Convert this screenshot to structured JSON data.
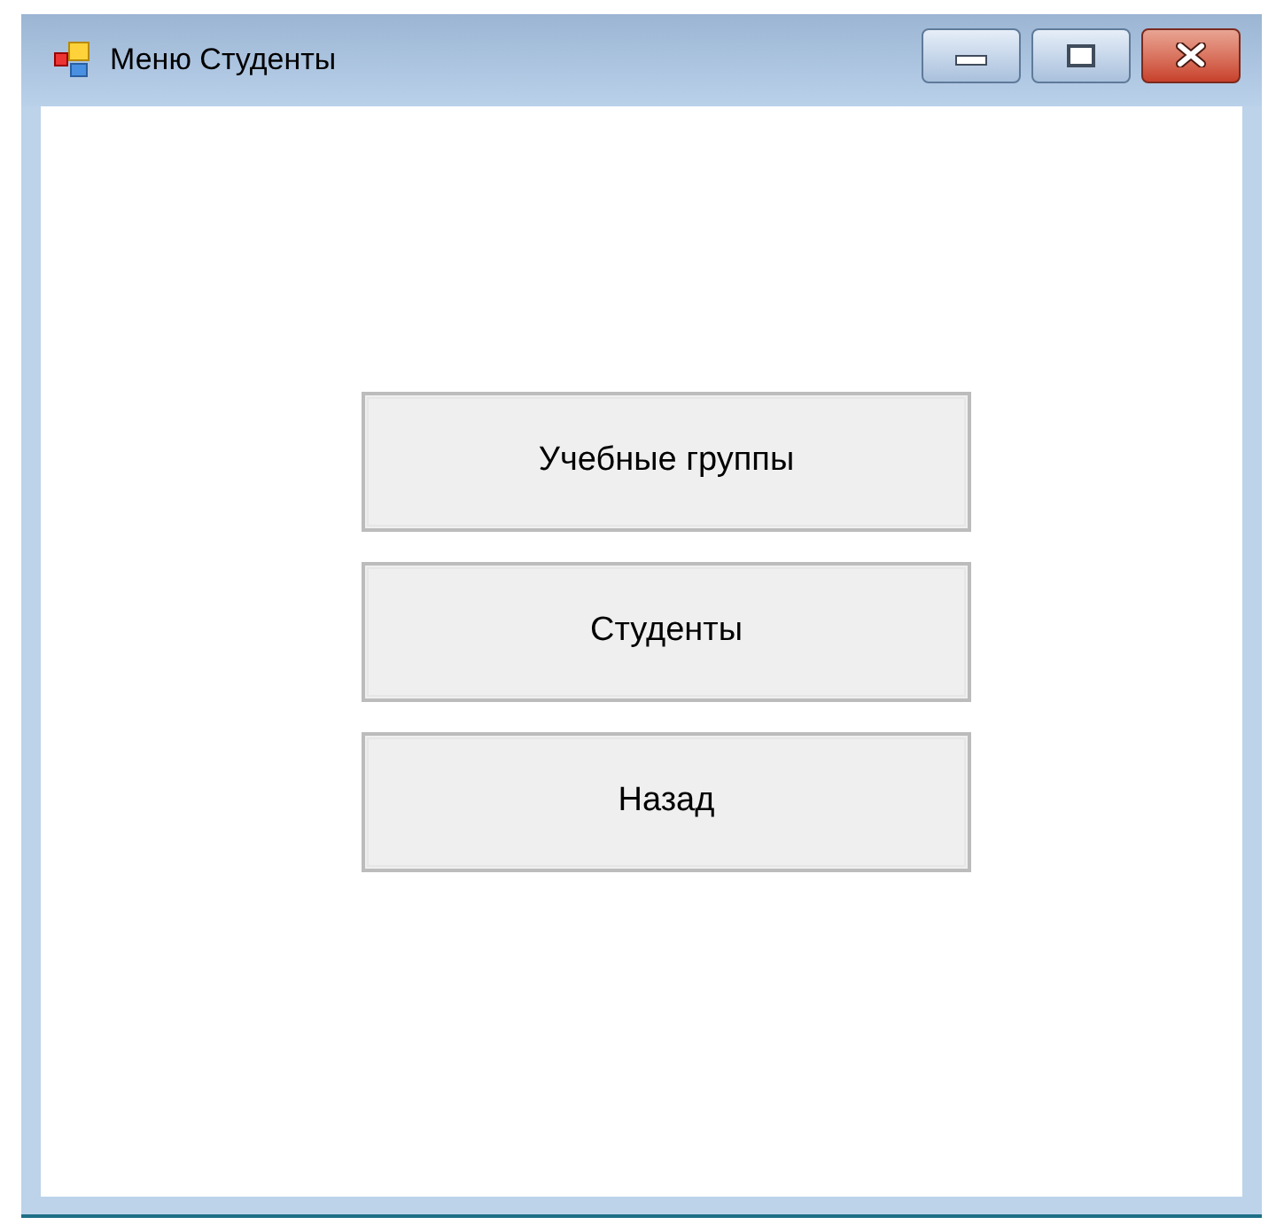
{
  "window": {
    "title": "Меню Студенты"
  },
  "buttons": [
    "Учебные группы",
    "Студенты",
    "Назад"
  ]
}
